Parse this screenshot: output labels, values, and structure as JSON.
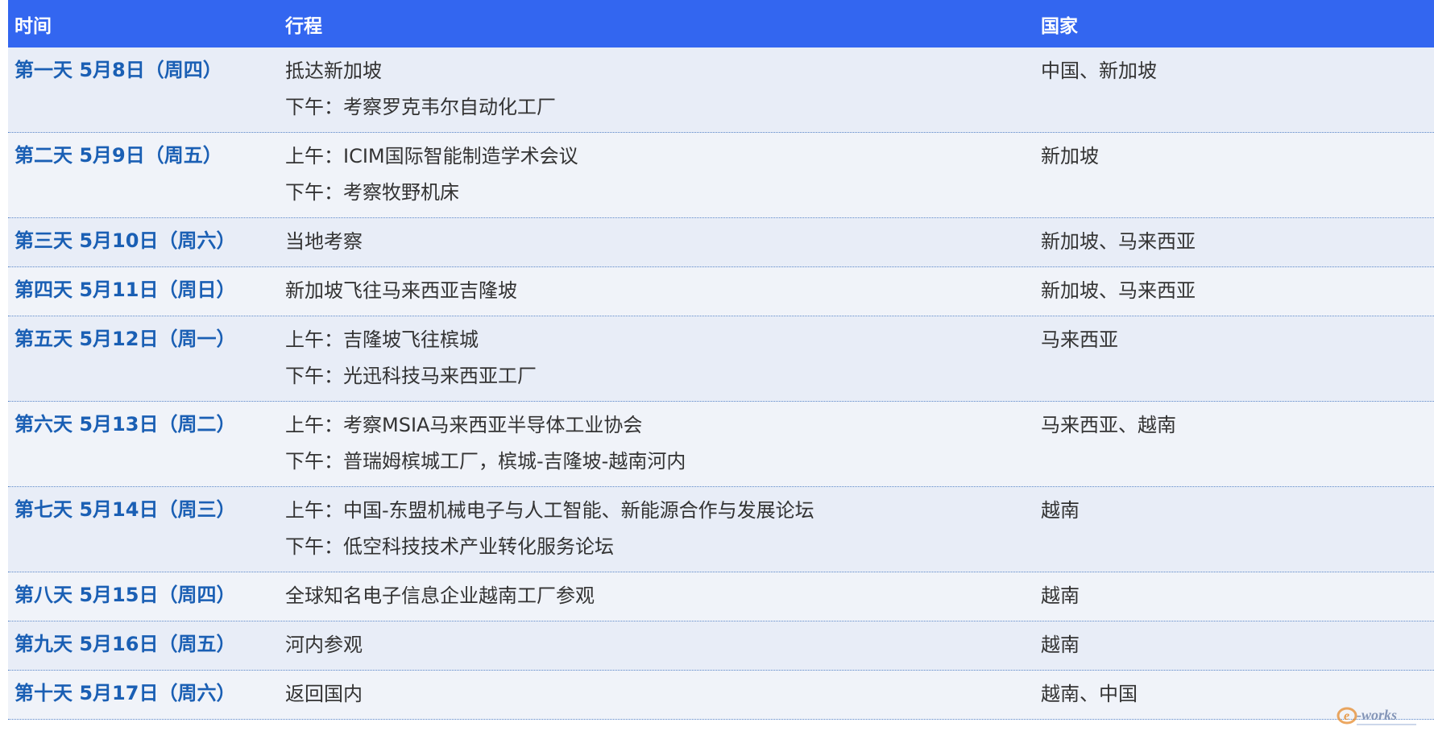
{
  "header": {
    "time": "时间",
    "trip": "行程",
    "country": "国家"
  },
  "rows": [
    {
      "time": "第一天 5月8日（周四）",
      "trip": [
        "抵达新加坡",
        "下午：考察罗克韦尔自动化工厂"
      ],
      "country": "中国、新加坡"
    },
    {
      "time": "第二天 5月9日（周五）",
      "trip": [
        "上午：ICIM国际智能制造学术会议",
        "下午：考察牧野机床"
      ],
      "country": "新加坡"
    },
    {
      "time": "第三天 5月10日（周六）",
      "trip": [
        "当地考察"
      ],
      "country": "新加坡、马来西亚"
    },
    {
      "time": "第四天 5月11日（周日）",
      "trip": [
        "新加坡飞往马来西亚吉隆坡"
      ],
      "country": "新加坡、马来西亚"
    },
    {
      "time": "第五天 5月12日（周一）",
      "trip": [
        "上午：吉隆坡飞往槟城",
        "下午：光迅科技马来西亚工厂"
      ],
      "country": "马来西亚"
    },
    {
      "time": "第六天 5月13日（周二）",
      "trip": [
        "上午：考察MSIA马来西亚半导体工业协会",
        "下午：普瑞姆槟城工厂，槟城-吉隆坡-越南河内"
      ],
      "country": "马来西亚、越南"
    },
    {
      "time": "第七天 5月14日（周三）",
      "trip": [
        "上午：中国-东盟机械电子与人工智能、新能源合作与发展论坛",
        "下午：低空科技技术产业转化服务论坛"
      ],
      "country": "越南"
    },
    {
      "time": "第八天 5月15日（周四）",
      "trip": [
        "全球知名电子信息企业越南工厂参观"
      ],
      "country": "越南"
    },
    {
      "time": "第九天 5月16日（周五）",
      "trip": [
        "河内参观"
      ],
      "country": "越南"
    },
    {
      "time": "第十天 5月17日（周六）",
      "trip": [
        "返回国内"
      ],
      "country": "越南、中国"
    }
  ],
  "watermark": "e-works",
  "colors": {
    "header_bg": "#3366f0",
    "time_text": "#1a5fb4",
    "row_odd": "#e8edf7",
    "row_even": "#f0f3f9"
  }
}
